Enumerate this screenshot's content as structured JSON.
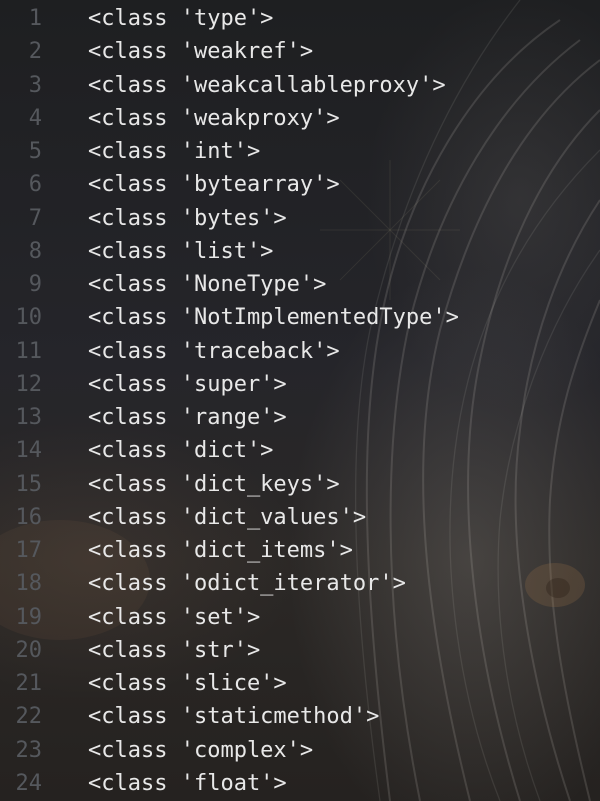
{
  "colors": {
    "text": "#e8e8e8",
    "line_number": "#55585d",
    "background": "#1e1f21"
  },
  "editor": {
    "lines": [
      {
        "number": "1",
        "text": "<class 'type'>"
      },
      {
        "number": "2",
        "text": "<class 'weakref'>"
      },
      {
        "number": "3",
        "text": "<class 'weakcallableproxy'>"
      },
      {
        "number": "4",
        "text": "<class 'weakproxy'>"
      },
      {
        "number": "5",
        "text": "<class 'int'>"
      },
      {
        "number": "6",
        "text": "<class 'bytearray'>"
      },
      {
        "number": "7",
        "text": "<class 'bytes'>"
      },
      {
        "number": "8",
        "text": "<class 'list'>"
      },
      {
        "number": "9",
        "text": "<class 'NoneType'>"
      },
      {
        "number": "10",
        "text": "<class 'NotImplementedType'>"
      },
      {
        "number": "11",
        "text": "<class 'traceback'>"
      },
      {
        "number": "12",
        "text": "<class 'super'>"
      },
      {
        "number": "13",
        "text": "<class 'range'>"
      },
      {
        "number": "14",
        "text": "<class 'dict'>"
      },
      {
        "number": "15",
        "text": "<class 'dict_keys'>"
      },
      {
        "number": "16",
        "text": "<class 'dict_values'>"
      },
      {
        "number": "17",
        "text": "<class 'dict_items'>"
      },
      {
        "number": "18",
        "text": "<class 'odict_iterator'>"
      },
      {
        "number": "19",
        "text": "<class 'set'>"
      },
      {
        "number": "20",
        "text": "<class 'str'>"
      },
      {
        "number": "21",
        "text": "<class 'slice'>"
      },
      {
        "number": "22",
        "text": "<class 'staticmethod'>"
      },
      {
        "number": "23",
        "text": "<class 'complex'>"
      },
      {
        "number": "24",
        "text": "<class 'float'>"
      }
    ]
  }
}
